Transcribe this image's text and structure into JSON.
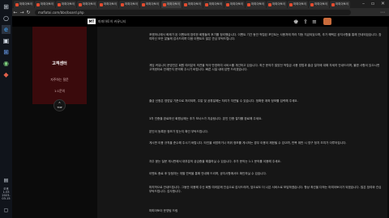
{
  "browser": {
    "url": "mafiatoi.com/bbs/board.php",
    "tabs": [
      "마피아토이",
      "마피아토이",
      "마피아토이",
      "마피아토이",
      "마피아토이",
      "마피아토이",
      "마피아토이",
      "마피아토이",
      "마피아토이",
      "마피아토이",
      "마피아토이",
      "마피아토이",
      "마피아토이",
      "마피아토이",
      "마피아토이",
      "마피아토이"
    ]
  },
  "taskbar": {
    "clock_time": "오후 1:33",
    "clock_date": "2023-03-15"
  },
  "site": {
    "logo_text": "MT",
    "logo_sub": "마피아토이 커뮤니티"
  },
  "sidebar": {
    "title": "고객센터",
    "links": [
      "자주하는 질문",
      "1:1문의"
    ]
  },
  "top_button": {
    "label": "TOP"
  },
  "article": {
    "paragraphs": [
      "포켓머니에서 화제가 된 이벤트에 참여한 회원들의 후기를 정리했습니다. 이벤트 기간 동안 적립된 포인트는 사용처에 따라 차등 지급되었으며, 추가 혜택은 공지사항을 통해 안내되었습니다. 참여하신 모든 분들께 감사드리며 다음 이벤트도 많은 관심 부탁드립니다.",
      "게임 커뮤니티 운영진은 회원 여러분의 의견을 적극 반영하여 서비스를 개선하고 있습니다. 최근 문의가 많았던 적립금 사용 방법과 출금 절차에 대해 자세히 안내드리며, 불편 사항이 있으시면 고객센터로 언제든지 문의해 주시기 바랍니다. 빠른 시일 내에 답변 드리겠습니다.",
      "출금 신청은 영업일 기준으로 처리되며, 주말 및 공휴일에는 처리가 지연될 수 있습니다. 정확한 계좌 정보를 입력해 주세요.",
      "3차 인증을 완료하신 회원님께는 추가 보너스가 지급됩니다. 본인 인증 절차를 완료해 주세요.",
      "본인이 등록한 정보가 맞는지 확인 부탁드립니다.",
      "게시판 이용 규칙을 준수해 주시기 바랍니다. 타인을 비방하거나 허위 정보를 게시하는 경우 이용이 제한될 수 있으며, 반복 위반 시 영구 정지 조치가 이루어집니다.",
      "자주 묻는 질문 게시판에서 대부분의 궁금증을 해결하실 수 있습니다. 추가 문의는 1:1 문의를 이용해 주세요.",
      "이벤트 종료 후 당첨자는 개별 연락을 통해 안내해 드리며, 공지사항에서도 확인하실 수 있습니다.",
      "마지막으로 안내드립니다. 그동안 이용해 주신 회원 여러분께 진심으로 감사드리며, 앞으로도 더 나은 서비스로 보답하겠습니다. 항상 최선을 다하는 마피아토이가 되겠습니다. 많은 참여와 관심 부탁드립니다. 감사합니다.",
      "마피아토이 운영팀 드림"
    ]
  }
}
